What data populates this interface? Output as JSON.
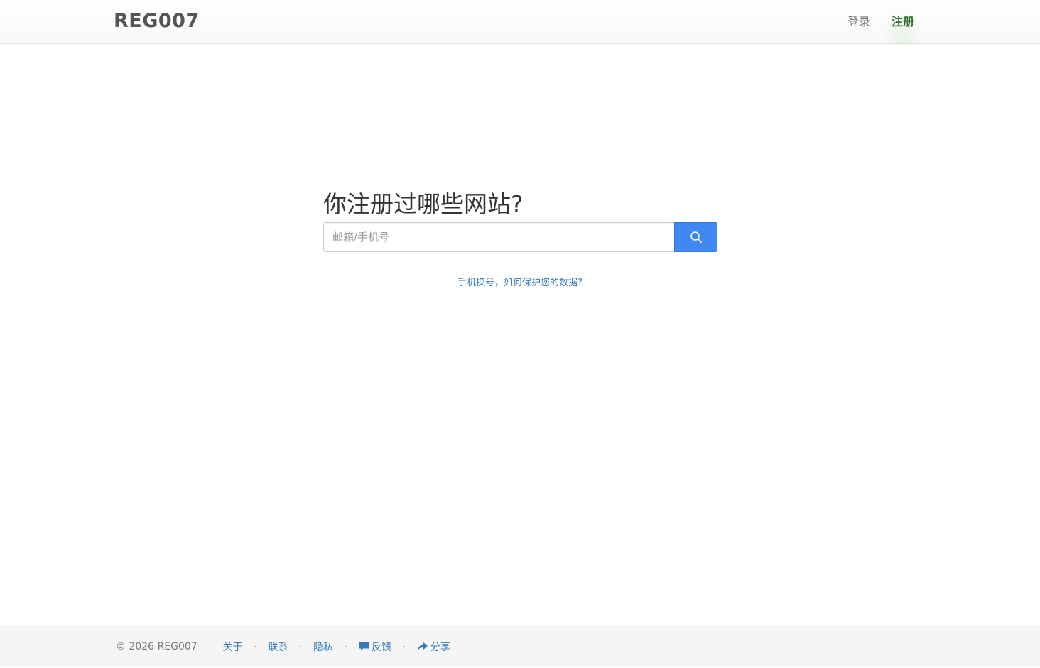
{
  "navbar": {
    "brand": "REG007",
    "links": [
      {
        "label": "登录",
        "active": false
      },
      {
        "label": "注册",
        "active": true
      }
    ]
  },
  "main": {
    "headline": "你注册过哪些网站?",
    "search": {
      "placeholder": "邮箱/手机号",
      "value": "",
      "button_icon": "search-icon"
    },
    "help_link": "手机换号，如何保护您的数据?"
  },
  "footer": {
    "copyright": "© 2026 REG007",
    "separator": "·",
    "links": [
      {
        "label": "关于",
        "icon": ""
      },
      {
        "label": "联系",
        "icon": ""
      },
      {
        "label": "隐私",
        "icon": ""
      },
      {
        "label": "反馈",
        "icon": "comment-icon"
      },
      {
        "label": "分享",
        "icon": "share-icon"
      }
    ]
  },
  "colors": {
    "accent": "#3f87f2",
    "link": "#337ab7",
    "active_nav": "#2f6e2f",
    "footer_bg": "#f5f5f5"
  }
}
